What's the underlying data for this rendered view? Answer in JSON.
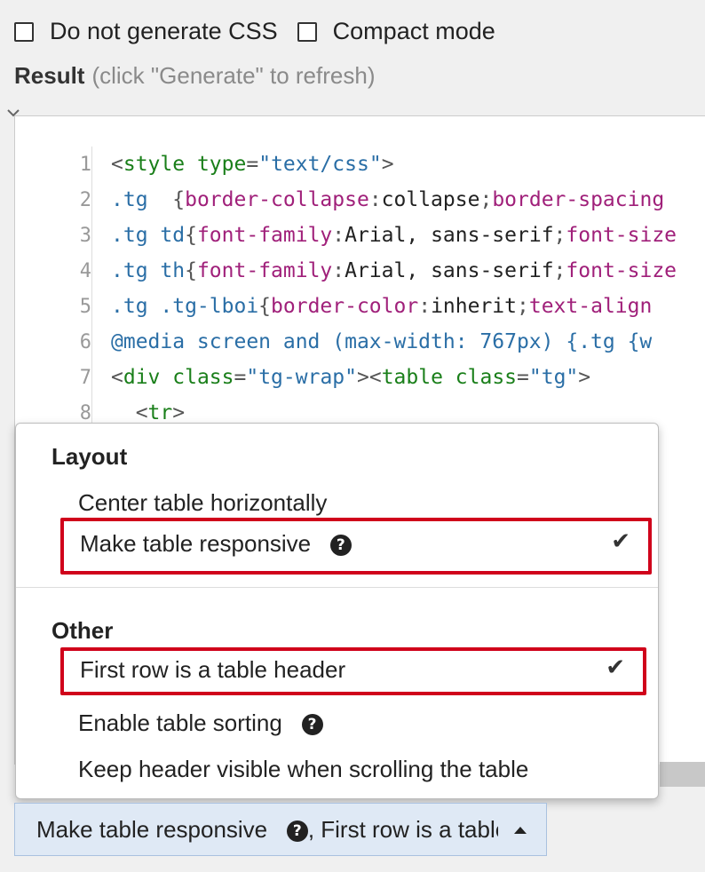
{
  "options": {
    "no_css_label": "Do not generate CSS",
    "compact_label": "Compact mode"
  },
  "result": {
    "title": "Result",
    "hint": "(click \"Generate\" to refresh)"
  },
  "editor": {
    "line_numbers": [
      "1",
      "2",
      "3",
      "4",
      "5",
      "6",
      "7",
      "8"
    ],
    "lines": [
      [
        {
          "t": "<",
          "c": "punct"
        },
        {
          "t": "style",
          "c": "tag"
        },
        {
          "t": " type",
          "c": "attr"
        },
        {
          "t": "=",
          "c": "punct"
        },
        {
          "t": "\"text/css\"",
          "c": "str"
        },
        {
          "t": ">",
          "c": "punct"
        }
      ],
      [
        {
          "t": ".tg",
          "c": "sel"
        },
        {
          "t": "  {",
          "c": "punct"
        },
        {
          "t": "border-collapse",
          "c": "prop"
        },
        {
          "t": ":",
          "c": "punct"
        },
        {
          "t": "collapse",
          "c": "val"
        },
        {
          "t": ";",
          "c": "punct"
        },
        {
          "t": "border-spacing",
          "c": "prop"
        }
      ],
      [
        {
          "t": ".tg td",
          "c": "sel"
        },
        {
          "t": "{",
          "c": "punct"
        },
        {
          "t": "font-family",
          "c": "prop"
        },
        {
          "t": ":",
          "c": "punct"
        },
        {
          "t": "Arial, sans-serif",
          "c": "val"
        },
        {
          "t": ";",
          "c": "punct"
        },
        {
          "t": "font-size",
          "c": "prop"
        }
      ],
      [
        {
          "t": ".tg th",
          "c": "sel"
        },
        {
          "t": "{",
          "c": "punct"
        },
        {
          "t": "font-family",
          "c": "prop"
        },
        {
          "t": ":",
          "c": "punct"
        },
        {
          "t": "Arial, sans-serif",
          "c": "val"
        },
        {
          "t": ";",
          "c": "punct"
        },
        {
          "t": "font-size",
          "c": "prop"
        }
      ],
      [
        {
          "t": ".tg .tg-lboi",
          "c": "sel"
        },
        {
          "t": "{",
          "c": "punct"
        },
        {
          "t": "border-color",
          "c": "prop"
        },
        {
          "t": ":",
          "c": "punct"
        },
        {
          "t": "inherit",
          "c": "val"
        },
        {
          "t": ";",
          "c": "punct"
        },
        {
          "t": "text-align",
          "c": "prop"
        }
      ],
      [
        {
          "t": "@media screen and (max-width: 767px) {.tg {w",
          "c": "kw"
        }
      ],
      [
        {
          "t": "<",
          "c": "punct"
        },
        {
          "t": "div",
          "c": "tag"
        },
        {
          "t": " class",
          "c": "attr"
        },
        {
          "t": "=",
          "c": "punct"
        },
        {
          "t": "\"tg-wrap\"",
          "c": "str"
        },
        {
          "t": "><",
          "c": "punct"
        },
        {
          "t": "table",
          "c": "tag"
        },
        {
          "t": " class",
          "c": "attr"
        },
        {
          "t": "=",
          "c": "punct"
        },
        {
          "t": "\"tg\"",
          "c": "str"
        },
        {
          "t": ">",
          "c": "punct"
        }
      ],
      [
        {
          "t": "  <",
          "c": "punct"
        },
        {
          "t": "tr",
          "c": "tag"
        },
        {
          "t": ">",
          "c": "punct"
        }
      ]
    ]
  },
  "menu": {
    "layout_title": "Layout",
    "center_label": "Center table horizontally",
    "responsive_label": "Make table responsive",
    "other_title": "Other",
    "header_label": "First row is a table header",
    "sorting_label": "Enable table sorting",
    "sticky_label": "Keep header visible when scrolling the table",
    "check_glyph": "✔",
    "help_glyph": "?"
  },
  "dropdown": {
    "text_part1": "Make table responsive",
    "text_part2": ", First row is a table header"
  },
  "colors": {
    "highlight_border": "#d0021b",
    "dropdown_bg": "#dfe9f5"
  }
}
